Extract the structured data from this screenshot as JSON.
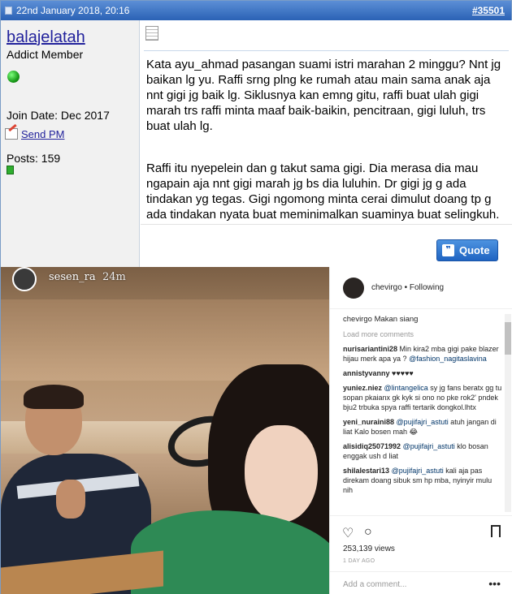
{
  "header": {
    "date": "22nd January 2018, 20:16",
    "post_number": "#35501"
  },
  "user": {
    "username": "balajelatah",
    "title": "Addict Member",
    "join_date": "Join Date: Dec 2017",
    "send_pm": "Send PM",
    "posts": "Posts: 159"
  },
  "post": {
    "paragraph1": "Kata ayu_ahmad pasangan suami istri marahan 2 minggu? Nnt jg baikan lg yu. Raffi srng plng ke rumah atau main sama anak aja nnt gigi jg baik lg. Siklusnya kan emng gitu, raffi buat ulah gigi marah trs raffi minta maaf baik-baikin, pencitraan, gigi luluh, trs buat ulah lg.",
    "paragraph2": "Raffi itu nyepelein dan g takut sama gigi. Dia merasa dia mau ngapain aja nnt gigi marah jg bs dia luluhin. Dr gigi jg g ada tindakan yg tegas. Gigi ngomong minta cerai dimulut doang tp g ada tindakan nyata buat meminimalkan suaminya buat selingkuh.",
    "quote_label": "Quote"
  },
  "story": {
    "user": "sesen_ra",
    "time": "24m"
  },
  "instagram": {
    "user": "chevirgo",
    "follow": "Following",
    "caption_user": "chevirgo",
    "caption": "Makan siang",
    "load_more": "Load more comments",
    "comments": [
      {
        "user": "nurisariantini28",
        "text": "Min kira2 mba gigi pake blazer hijau merk apa ya ?",
        "mention": "@fashion_nagitaslavina"
      },
      {
        "user": "annistyvanny",
        "text": "♥♥♥♥♥",
        "mention": ""
      },
      {
        "user": "yuniez.niez",
        "mention": "@lintangelica",
        "text": "sy jg fans beratx gg tu sopan pkaianx gk kyk si ono no pke rok2' pndek bju2 trbuka spya raffi tertarik dongkol.lhtx"
      },
      {
        "user": "yeni_nuraini88",
        "mention": "@pujifajri_astuti",
        "text": "atuh jangan di liat Kalo bosen mah 😂"
      },
      {
        "user": "alisidiq25071992",
        "mention": "@pujifajri_astuti",
        "text": "klo bosan enggak ush d liat"
      },
      {
        "user": "shilalestari13",
        "mention": "@pujifajri_astuti",
        "text": "kali aja pas direkam doang sibuk sm hp mba, nyinyir mulu nih"
      }
    ],
    "views": "253,139 views",
    "date": "1 DAY AGO",
    "add_comment": "Add a comment...",
    "more": "•••"
  }
}
